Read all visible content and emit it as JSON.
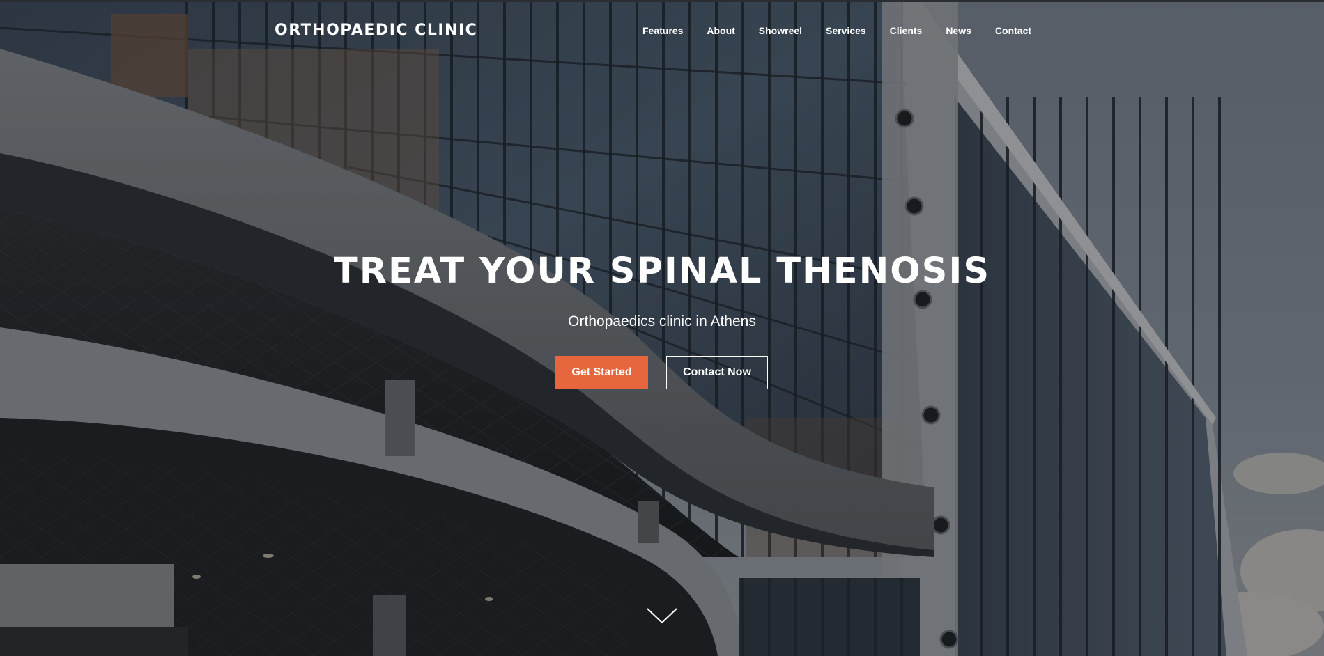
{
  "header": {
    "brand": "ORTHOPAEDIC CLINIC",
    "nav": [
      {
        "label": "Features"
      },
      {
        "label": "About"
      },
      {
        "label": "Showreel"
      },
      {
        "label": "Services"
      },
      {
        "label": "Clients"
      },
      {
        "label": "News"
      },
      {
        "label": "Contact"
      }
    ]
  },
  "hero": {
    "headline": "TREAT YOUR SPINAL THENOSIS",
    "subheadline": "Orthopaedics clinic in Athens",
    "primary_button": "Get Started",
    "secondary_button": "Contact Now",
    "scroll_icon": "chevron-down-icon",
    "background_image": "glass-building-facade"
  },
  "colors": {
    "accent": "#e8663d",
    "text": "#ffffff"
  }
}
